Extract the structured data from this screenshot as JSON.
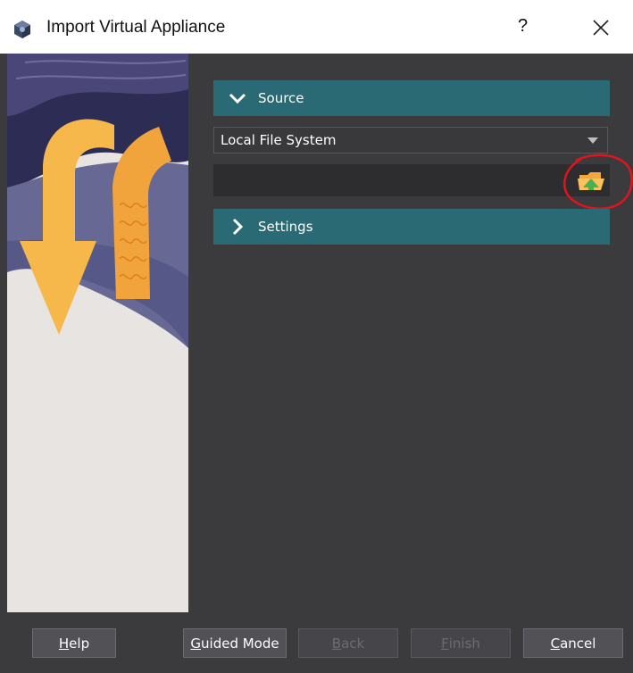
{
  "window": {
    "title": "Import Virtual Appliance",
    "help_glyph": "?",
    "close_icon": "close-icon",
    "app_icon": "virtualbox-cube-icon"
  },
  "colors": {
    "section_header": "#2a6a74",
    "content_bg": "#3b3b3e",
    "annotation": "#e0141e",
    "art_arrow": "#f6b84a",
    "art_wave": "#f0a23a",
    "art_sky": "#2f2f55"
  },
  "source_section": {
    "label": "Source",
    "expanded": true,
    "icon": "chevron-down-icon",
    "source_select": {
      "value": "Local File System"
    },
    "file_path": {
      "value": "",
      "placeholder": ""
    },
    "browse_icon": "folder-open-icon"
  },
  "settings_section": {
    "label": "Settings",
    "expanded": false,
    "icon": "chevron-right-icon"
  },
  "footer": {
    "help": {
      "mnemonic": "H",
      "rest": "elp"
    },
    "guided_mode": {
      "mnemonic": "G",
      "rest": "uided Mode"
    },
    "back": {
      "mnemonic": "B",
      "rest": "ack",
      "enabled": false
    },
    "finish": {
      "mnemonic": "F",
      "rest": "inish",
      "enabled": false
    },
    "cancel": {
      "mnemonic": "C",
      "rest": "ancel"
    }
  }
}
